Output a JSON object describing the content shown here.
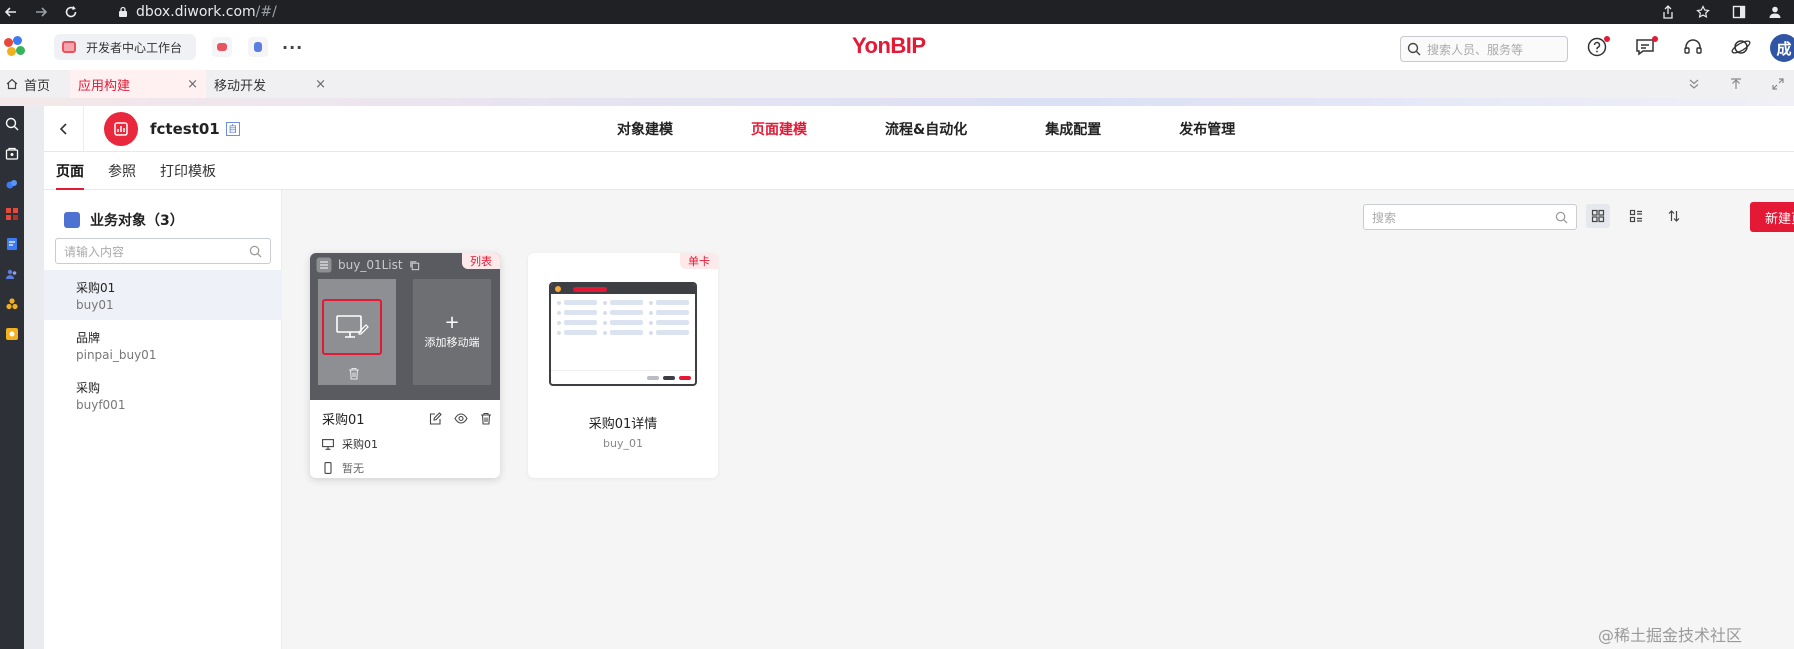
{
  "browser": {
    "url_host": "dbox.diwork.com",
    "url_path": "/#/"
  },
  "header": {
    "tab_chip_label": "开发者中心工作台",
    "brand": "YonBIP",
    "search_placeholder": "搜索人员、服务等",
    "avatar_text": "成"
  },
  "page_tabs": [
    {
      "label": "首页"
    },
    {
      "label": "应用构建",
      "close": "×"
    },
    {
      "label": "移动开发",
      "close": "×"
    }
  ],
  "app": {
    "name": "fctest01",
    "badge": "自"
  },
  "top_nav": [
    "对象建模",
    "页面建模",
    "流程&自动化",
    "集成配置",
    "发布管理"
  ],
  "top_nav_active": "页面建模",
  "sub_tabs": [
    "页面",
    "参照",
    "打印模板"
  ],
  "sidebar": {
    "title": "业务对象（3）",
    "search_placeholder": "请输入内容",
    "items": [
      {
        "name": "采购01",
        "code": "buy01"
      },
      {
        "name": "品牌",
        "code": "pinpai_buy01"
      },
      {
        "name": "采购",
        "code": "buyf001"
      }
    ]
  },
  "content": {
    "search_placeholder": "搜索",
    "new_button": "新建页面",
    "cards": [
      {
        "code_name": "buy_01List",
        "tag": "列表",
        "add_mobile": "添加移动端",
        "title": "采购01",
        "pc_label": "采购01",
        "mobile_label": "暂无"
      },
      {
        "tag": "单卡",
        "title": "采购01详情",
        "code": "buy_01"
      }
    ]
  },
  "watermark": "@稀土掘金技术社区",
  "colors": {
    "accent": "#e31936",
    "rail": "#2d3037",
    "blue": "#4d72d1"
  }
}
